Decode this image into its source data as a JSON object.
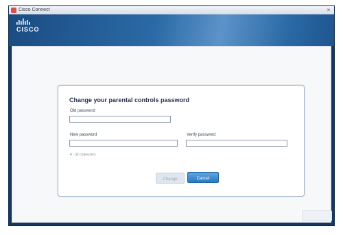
{
  "window": {
    "title": "Cisco Connect",
    "close_glyph": "×"
  },
  "brand": {
    "name": "CISCO",
    "color": "#ffffff"
  },
  "dialog": {
    "heading": "Change your parental controls password",
    "old_password_label": "Old password",
    "new_password_label": "New password",
    "verify_password_label": "Verify password",
    "hint": "4 - 32 characters",
    "change_label": "Change",
    "cancel_label": "Cancel"
  },
  "colors": {
    "header_blue": "#1a4c82",
    "accent_button": "#2a79c0",
    "window_frame": "#14385f"
  },
  "icons": [
    "cisco-connect-app-icon",
    "close-icon",
    "cisco-logo"
  ]
}
